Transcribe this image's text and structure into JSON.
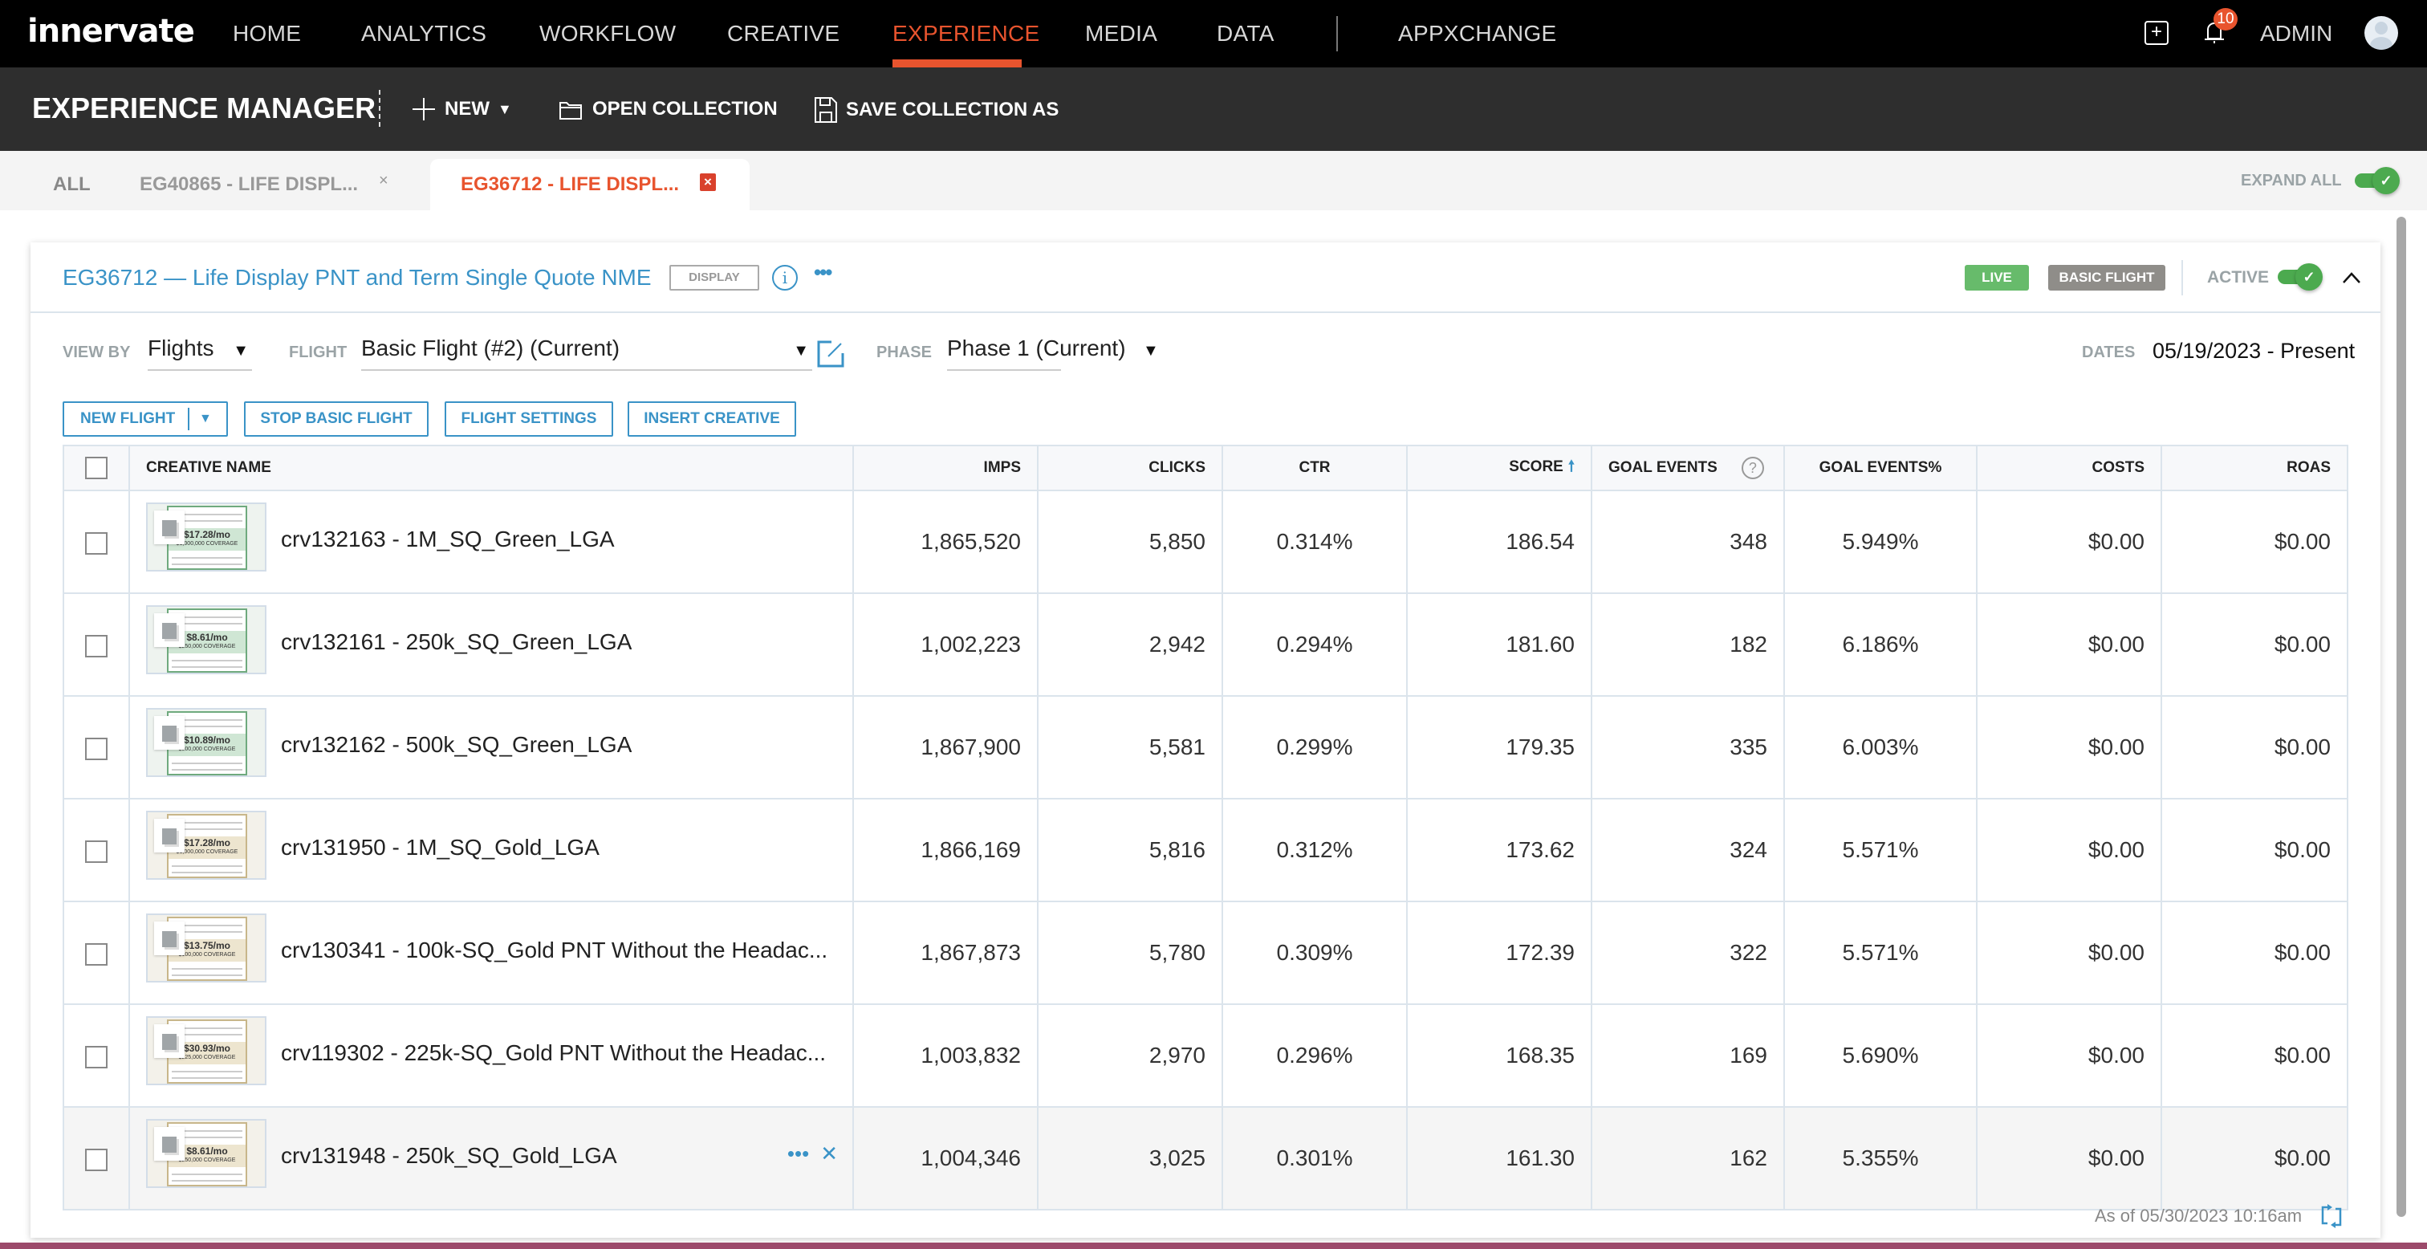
{
  "app": {
    "logo": "innervate",
    "nav": [
      {
        "label": "HOME",
        "active": false
      },
      {
        "label": "ANALYTICS",
        "active": false
      },
      {
        "label": "WORKFLOW",
        "active": false
      },
      {
        "label": "CREATIVE",
        "active": false
      },
      {
        "label": "EXPERIENCE",
        "active": true
      },
      {
        "label": "MEDIA",
        "active": false
      },
      {
        "label": "DATA",
        "active": false
      },
      {
        "label": "APPXCHANGE",
        "active": false
      }
    ],
    "notification_count": "10",
    "user_label": "ADMIN",
    "accent_color": "#e8542e"
  },
  "subbar": {
    "title": "EXPERIENCE MANAGER",
    "new_label": "NEW",
    "open_collection_label": "OPEN COLLECTION",
    "save_collection_label": "SAVE COLLECTION AS"
  },
  "tabs": {
    "all_label": "ALL",
    "items": [
      {
        "label": "EG40865 - LIFE DISPL...",
        "active": false
      },
      {
        "label": "EG36712 - LIFE DISPL...",
        "active": true
      }
    ],
    "expand_all_label": "EXPAND ALL",
    "expand_all_on": true
  },
  "card": {
    "title": "EG36712 — Life Display PNT and Term Single Quote NME",
    "type_badge": "DISPLAY",
    "status_badge": "LIVE",
    "flight_badge": "BASIC FLIGHT",
    "active_label": "ACTIVE",
    "active_on": true,
    "status_color": "#67bb6b"
  },
  "filters": {
    "view_by_label": "VIEW BY",
    "view_by_value": "Flights",
    "flight_label": "FLIGHT",
    "flight_value": "Basic Flight (#2) (Current)",
    "phase_label": "PHASE",
    "phase_value": "Phase 1 (Current)",
    "dates_label": "DATES",
    "dates_value": "05/19/2023 - Present"
  },
  "actions": {
    "new_flight": "NEW FLIGHT",
    "stop_basic_flight": "STOP BASIC FLIGHT",
    "flight_settings": "FLIGHT SETTINGS",
    "insert_creative": "INSERT CREATIVE"
  },
  "table": {
    "columns": [
      "CREATIVE NAME",
      "IMPS",
      "CLICKS",
      "CTR",
      "SCORE",
      "GOAL EVENTS",
      "GOAL EVENTS%",
      "COSTS",
      "ROAS"
    ],
    "sorted_by": "SCORE",
    "sort_direction": "ascending-arrow",
    "rows": [
      {
        "name": "crv132163 - 1M_SQ_Green_LGA",
        "theme": "green",
        "price": "$17.28/mo",
        "coverage": "$1,000,000 COVERAGE",
        "imps": "1,865,520",
        "clicks": "5,850",
        "ctr": "0.314%",
        "score": "186.54",
        "goal_events": "348",
        "goal_events_pct": "5.949%",
        "costs": "$0.00",
        "roas": "$0.00"
      },
      {
        "name": "crv132161 - 250k_SQ_Green_LGA",
        "theme": "green",
        "price": "$8.61/mo",
        "coverage": "$250,000 COVERAGE",
        "imps": "1,002,223",
        "clicks": "2,942",
        "ctr": "0.294%",
        "score": "181.60",
        "goal_events": "182",
        "goal_events_pct": "6.186%",
        "costs": "$0.00",
        "roas": "$0.00"
      },
      {
        "name": "crv132162 - 500k_SQ_Green_LGA",
        "theme": "green",
        "price": "$10.89/mo",
        "coverage": "$500,000 COVERAGE",
        "imps": "1,867,900",
        "clicks": "5,581",
        "ctr": "0.299%",
        "score": "179.35",
        "goal_events": "335",
        "goal_events_pct": "6.003%",
        "costs": "$0.00",
        "roas": "$0.00"
      },
      {
        "name": "crv131950 - 1M_SQ_Gold_LGA",
        "theme": "gold",
        "price": "$17.28/mo",
        "coverage": "$1,000,000 COVERAGE",
        "imps": "1,866,169",
        "clicks": "5,816",
        "ctr": "0.312%",
        "score": "173.62",
        "goal_events": "324",
        "goal_events_pct": "5.571%",
        "costs": "$0.00",
        "roas": "$0.00"
      },
      {
        "name": "crv130341 - 100k-SQ_Gold PNT Without the Headac...",
        "theme": "gold",
        "price": "$13.75/mo",
        "coverage": "$100,000 COVERAGE",
        "imps": "1,867,873",
        "clicks": "5,780",
        "ctr": "0.309%",
        "score": "172.39",
        "goal_events": "322",
        "goal_events_pct": "5.571%",
        "costs": "$0.00",
        "roas": "$0.00"
      },
      {
        "name": "crv119302 - 225k-SQ_Gold PNT Without the Headac...",
        "theme": "gold",
        "price": "$30.93/mo",
        "coverage": "$225,000 COVERAGE",
        "imps": "1,003,832",
        "clicks": "2,970",
        "ctr": "0.296%",
        "score": "168.35",
        "goal_events": "169",
        "goal_events_pct": "5.690%",
        "costs": "$0.00",
        "roas": "$0.00"
      },
      {
        "name": "crv131948 - 250k_SQ_Gold_LGA",
        "theme": "gold",
        "price": "$8.61/mo",
        "coverage": "$250,000 COVERAGE",
        "imps": "1,004,346",
        "clicks": "3,025",
        "ctr": "0.301%",
        "score": "161.30",
        "goal_events": "162",
        "goal_events_pct": "5.355%",
        "costs": "$0.00",
        "roas": "$0.00",
        "hovered": true
      }
    ]
  },
  "footer": {
    "as_of": "As of 05/30/2023 10:16am"
  }
}
